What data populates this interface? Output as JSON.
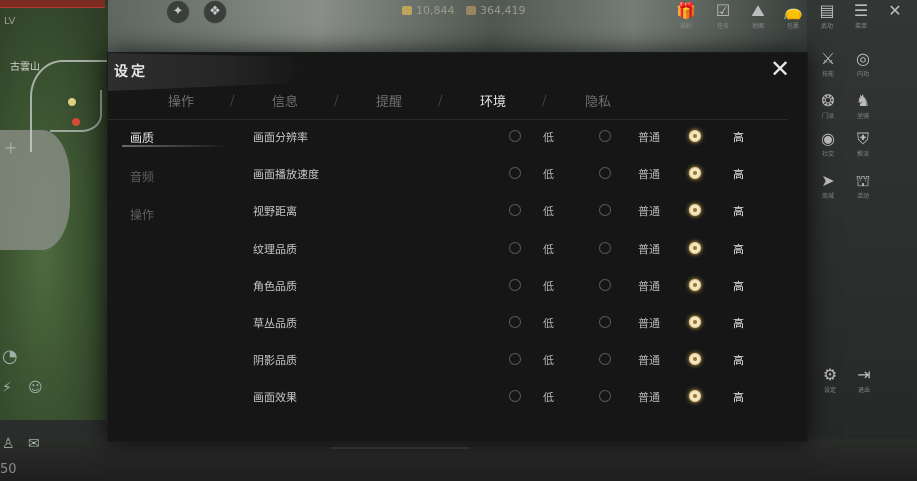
{
  "hud": {
    "hp_text": "LV",
    "map_label": "古雲山",
    "currency1": "10,844",
    "currency2": "364,419",
    "bottom_left_num": "50"
  },
  "right_icons": [
    {
      "icon": "gift-icon",
      "glyph": "🎁",
      "label": "福利"
    },
    {
      "icon": "quest-icon",
      "glyph": "☑",
      "label": "任务"
    },
    {
      "icon": "map-icon",
      "glyph": "⛰",
      "label": "地图"
    },
    {
      "icon": "bag-icon",
      "glyph": "👝",
      "label": "包裹"
    },
    {
      "icon": "book-icon",
      "glyph": "▤",
      "label": "武功"
    },
    {
      "icon": "menu-icon",
      "glyph": "☰",
      "label": "菜单"
    },
    {
      "icon": "close-x-icon",
      "glyph": "✕",
      "label": ""
    },
    {
      "icon": "skill-icon",
      "glyph": "⚔",
      "label": "技能"
    },
    {
      "icon": "swirl-icon",
      "glyph": "◎",
      "label": "内功"
    },
    {
      "icon": "wheel-icon",
      "glyph": "❂",
      "label": "门派"
    },
    {
      "icon": "dragon-icon",
      "glyph": "♞",
      "label": "坐骑"
    },
    {
      "icon": "ring-icon",
      "glyph": "◉",
      "label": "社交"
    },
    {
      "icon": "shield-icon",
      "glyph": "⛨",
      "label": "帮派"
    },
    {
      "icon": "arrow-icon",
      "glyph": "➤",
      "label": "商城"
    },
    {
      "icon": "people-icon",
      "glyph": "⛫",
      "label": "活动"
    },
    {
      "icon": "settings-gear-icon",
      "glyph": "⚙",
      "label": "设定"
    },
    {
      "icon": "logout-icon",
      "glyph": "⇥",
      "label": "退出"
    }
  ],
  "dialog": {
    "title": "设定",
    "close_glyph": "✕",
    "tabs": [
      "操作",
      "信息",
      "提醒",
      "环境",
      "隐私"
    ],
    "active_tab": 3,
    "categories": [
      "画质",
      "音频",
      "操作"
    ],
    "active_category": 0,
    "options": [
      "低",
      "普通",
      "高"
    ],
    "rows": [
      {
        "label": "画面分辨率",
        "selected": 2
      },
      {
        "label": "画面播放速度",
        "selected": 2
      },
      {
        "label": "视野距离",
        "selected": 2
      },
      {
        "label": "纹理品质",
        "selected": 2
      },
      {
        "label": "角色品质",
        "selected": 2
      },
      {
        "label": "草丛品质",
        "selected": 2
      },
      {
        "label": "阴影品质",
        "selected": 2
      },
      {
        "label": "画面效果",
        "selected": 2
      }
    ]
  },
  "colors": {
    "selected_radio": "#f1e8c8",
    "selected_glow": "#d8b35a",
    "dialog_bg": "#161616"
  }
}
